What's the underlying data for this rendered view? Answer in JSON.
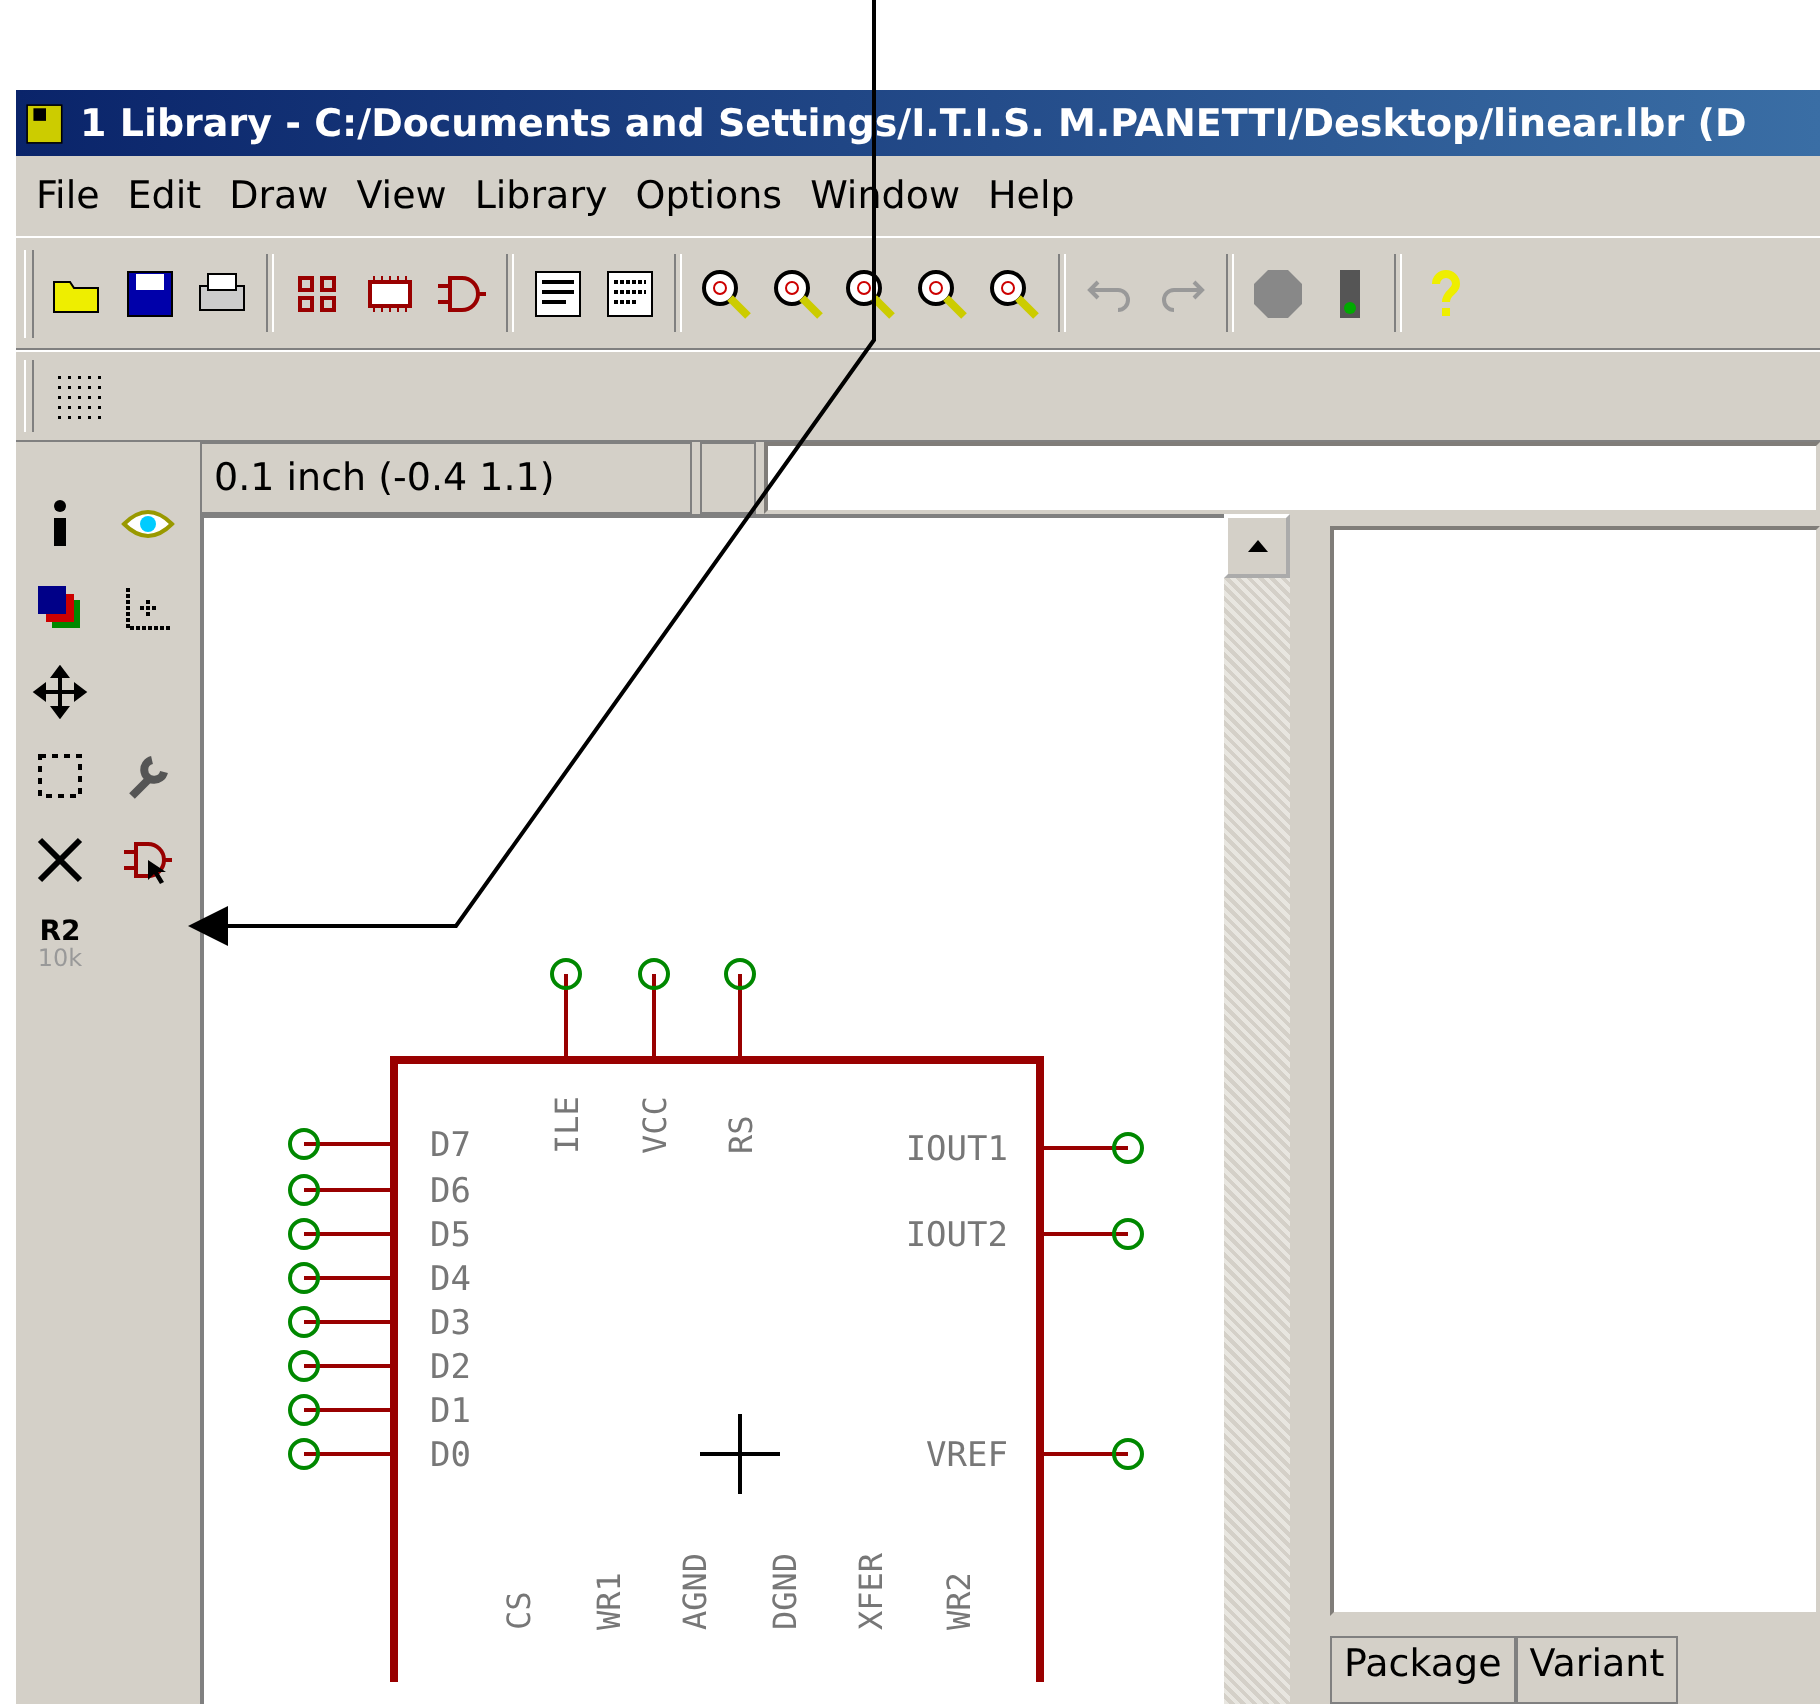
{
  "window": {
    "title": "1 Library - C:/Documents and Settings/I.T.I.S. M.PANETTI/Desktop/linear.lbr (D"
  },
  "menu": [
    "File",
    "Edit",
    "Draw",
    "View",
    "Library",
    "Options",
    "Window",
    "Help"
  ],
  "coordinates": {
    "value": "0.1 inch (-0.4 1.1)"
  },
  "symbol": {
    "left_pins": [
      "D7",
      "D6",
      "D5",
      "D4",
      "D3",
      "D2",
      "D1",
      "D0"
    ],
    "right_pins": [
      "IOUT1",
      "IOUT2",
      "VREF"
    ],
    "top_pins": [
      "ILE",
      "VCC",
      "RS"
    ],
    "bottom_pins": [
      "CS",
      "WR1",
      "AGND",
      "DGND",
      "XFER",
      "WR2"
    ]
  },
  "side_panel": {
    "tool_label": "R2",
    "tool_value": "10k"
  },
  "tabs": [
    {
      "label": "Package",
      "selected": false
    },
    {
      "label": "Variant",
      "selected": false
    }
  ]
}
